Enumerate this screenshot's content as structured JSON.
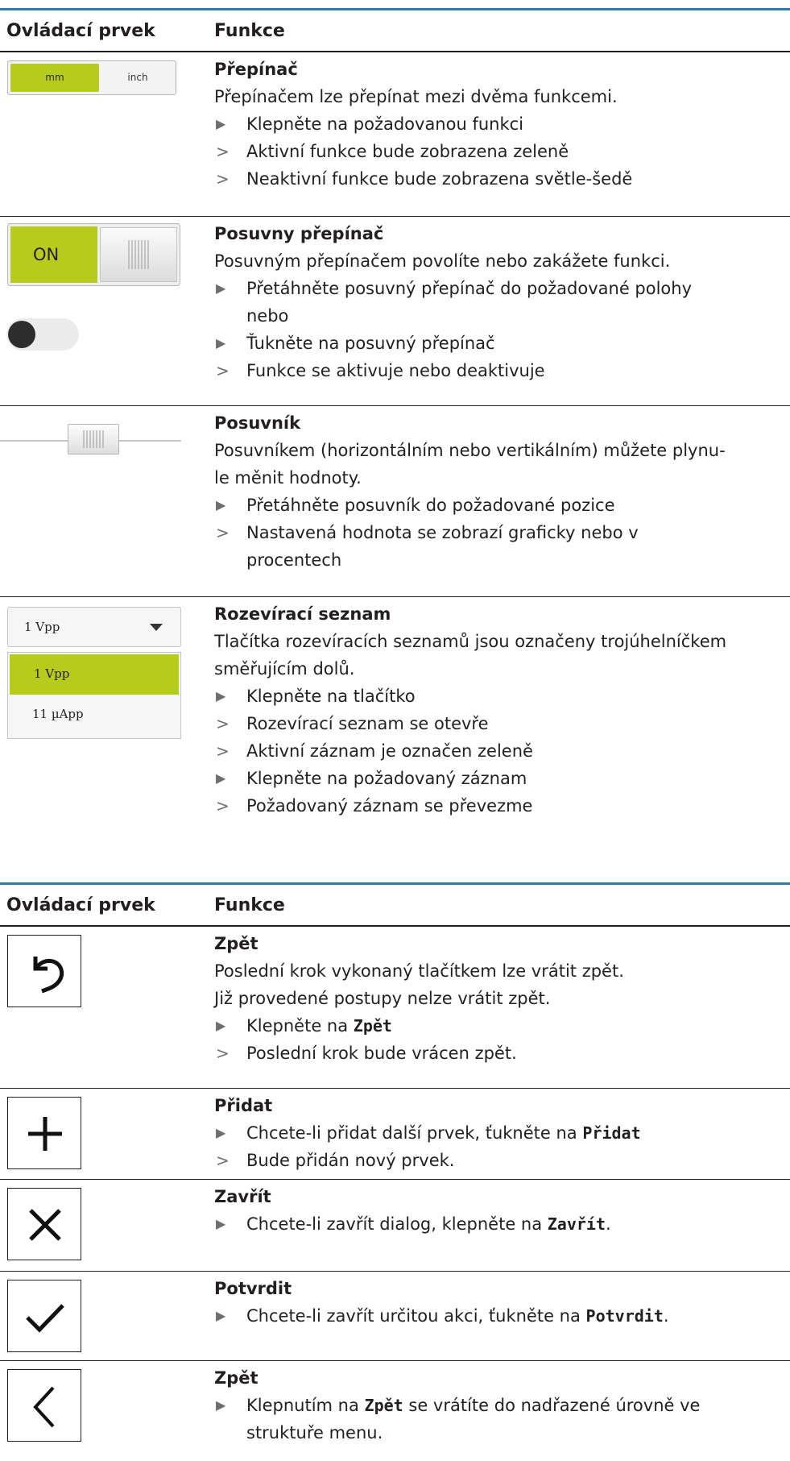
{
  "headers": {
    "control": "Ovládací prvek",
    "function": "Funkce"
  },
  "table1": {
    "rows": [
      {
        "control": {
          "left_label": "mm",
          "right_label": "inch"
        },
        "title": "Přepínač",
        "desc": "Přepínačem lze přepínat mezi dvěma funkcemi.",
        "steps": [
          {
            "marker": "▶",
            "text": "Klepněte na požadovanou funkci"
          },
          {
            "marker": ">",
            "text": "Aktivní funkce bude zobrazena zeleně"
          },
          {
            "marker": ">",
            "text": "Neaktivní funkce bude zobrazena světle-šedě"
          }
        ]
      },
      {
        "control": {
          "on_label": "ON"
        },
        "title": "Posuvny přepínač",
        "desc": "Posuvným přepínačem povolíte nebo zakážete funkci.",
        "steps": [
          {
            "marker": "▶",
            "text": "Přetáhněte posuvný přepínač do požadované polohy",
            "cont": "nebo"
          },
          {
            "marker": "▶",
            "text": "Ťukněte na posuvný přepínač"
          },
          {
            "marker": ">",
            "text": "Funkce se aktivuje nebo deaktivuje"
          }
        ]
      },
      {
        "title": "Posuvník",
        "desc_line1": "Posuvníkem (horizontálním nebo vertikálním) můžete plynu-",
        "desc_line2": "le měnit hodnoty.",
        "steps": [
          {
            "marker": "▶",
            "text": "Přetáhněte posuvník do požadované pozice"
          },
          {
            "marker": ">",
            "text": "Nastavená hodnota se zobrazí graficky nebo v",
            "cont": "procentech"
          }
        ]
      },
      {
        "control": {
          "selected": "1 Vpp",
          "options": [
            "1 Vpp",
            "11 µApp"
          ]
        },
        "title": "Rozevírací seznam",
        "desc_line1": "Tlačítka rozevíracích seznamů jsou označeny trojúhelníčkem",
        "desc_line2": "směřujícím dolů.",
        "steps": [
          {
            "marker": "▶",
            "text": "Klepněte na tlačítko"
          },
          {
            "marker": ">",
            "text": "Rozevírací seznam se otevře"
          },
          {
            "marker": ">",
            "text": "Aktivní záznam je označen zeleně"
          },
          {
            "marker": "▶",
            "text": "Klepněte na požadovaný záznam"
          },
          {
            "marker": ">",
            "text": "Požadovaný záznam se převezme"
          }
        ]
      }
    ]
  },
  "table2": {
    "rows": [
      {
        "icon": "undo-icon",
        "title": "Zpět",
        "desc_line1": "Poslední krok vykonaný tlačítkem lze vrátit zpět.",
        "desc_line2": "Již provedené postupy nelze vrátit zpět.",
        "steps": [
          {
            "marker": "▶",
            "text": "Klepněte na ",
            "kw": "Zpět"
          },
          {
            "marker": ">",
            "text": "Poslední krok bude vrácen zpět."
          }
        ]
      },
      {
        "icon": "plus-icon",
        "title": "Přidat",
        "steps": [
          {
            "marker": "▶",
            "text": "Chcete-li přidat další prvek, ťukněte na ",
            "kw": "Přidat"
          },
          {
            "marker": ">",
            "text": "Bude přidán nový prvek."
          }
        ]
      },
      {
        "icon": "close-icon",
        "title": "Zavřít",
        "steps": [
          {
            "marker": "▶",
            "text": "Chcete-li zavřít dialog, klepněte na ",
            "kw": "Zavřít",
            "after": "."
          }
        ]
      },
      {
        "icon": "check-icon",
        "title": "Potvrdit",
        "steps": [
          {
            "marker": "▶",
            "text": "Chcete-li zavřít určitou akci, ťukněte na ",
            "kw": "Potvrdit",
            "after": "."
          }
        ]
      },
      {
        "icon": "chevron-left-icon",
        "title": "Zpět",
        "steps": [
          {
            "marker": "▶",
            "text": "Klepnutím na ",
            "kw": "Zpět",
            "after": " se vrátíte do nadřazené úrovně ve",
            "cont": "struktuře menu."
          }
        ]
      }
    ]
  }
}
